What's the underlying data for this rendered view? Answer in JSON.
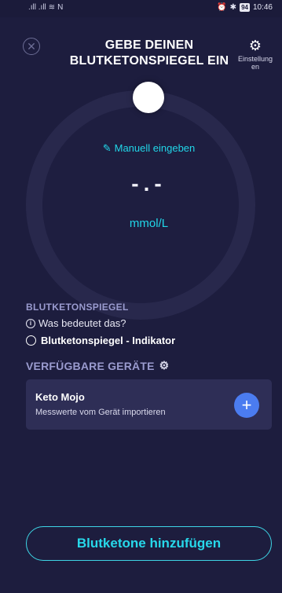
{
  "status_bar": {
    "signal": ".ıll .ıll",
    "wifi": "≋",
    "nfc": "N",
    "alarm": "⏰",
    "bluetooth": "✱",
    "battery": "94",
    "time": "10:46"
  },
  "header": {
    "title": "GEBE DEINEN BLUTKETONSPIEGEL EIN",
    "settings_label": "Einstellungen"
  },
  "dial": {
    "manual_entry": "Manuell eingeben",
    "value": "-.-",
    "unit": "mmol/L"
  },
  "blood_ketone": {
    "section_title": "BLUTKETONSPIEGEL",
    "info_link": "Was bedeutet das?",
    "indicator_label": "Blutketonspiegel - Indikator"
  },
  "devices": {
    "section_title": "VERFÜGBARE GERÄTE",
    "items": [
      {
        "name": "Keto Mojo",
        "description": "Messwerte vom Gerät importieren"
      }
    ]
  },
  "footer": {
    "add_button": "Blutketone hinzufügen"
  },
  "colors": {
    "background": "#1d1d3e",
    "accent": "#27d8ea",
    "card": "#2e2e56",
    "plus_button": "#4b7cf0",
    "section_title": "#9a9bcf"
  }
}
